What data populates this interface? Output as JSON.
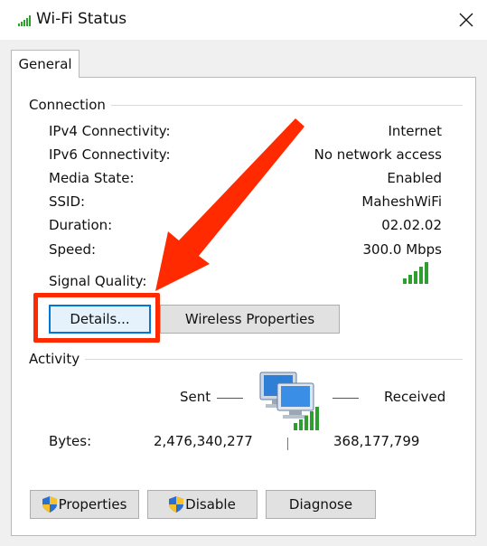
{
  "window": {
    "title": "Wi-Fi Status"
  },
  "tabs": [
    {
      "label": "General"
    }
  ],
  "connection": {
    "group_title": "Connection",
    "rows": [
      {
        "label": "IPv4 Connectivity:",
        "value": "Internet"
      },
      {
        "label": "IPv6 Connectivity:",
        "value": "No network access"
      },
      {
        "label": "Media State:",
        "value": "Enabled"
      },
      {
        "label": "SSID:",
        "value": "MaheshWiFi"
      },
      {
        "label": "Duration:",
        "value": "02.02.02"
      },
      {
        "label": "Speed:",
        "value": "300.0 Mbps"
      }
    ],
    "signal_label": "Signal Quality:",
    "signal_bars": 5,
    "details_button": "Details...",
    "wireless_properties_button": "Wireless Properties"
  },
  "activity": {
    "group_title": "Activity",
    "sent_label": "Sent",
    "received_label": "Received",
    "bytes_label": "Bytes:",
    "bytes_sent": "2,476,340,277",
    "bytes_received": "368,177,799"
  },
  "buttons": {
    "properties": "Properties",
    "disable": "Disable",
    "diagnose": "Diagnose"
  },
  "colors": {
    "annotation_red": "#ff2a00",
    "signal_green": "#2e9e2e",
    "focus_blue": "#0078d7"
  },
  "icons": [
    "wifi-signal-icon",
    "close-icon",
    "network-computers-icon",
    "uac-shield-icon"
  ]
}
